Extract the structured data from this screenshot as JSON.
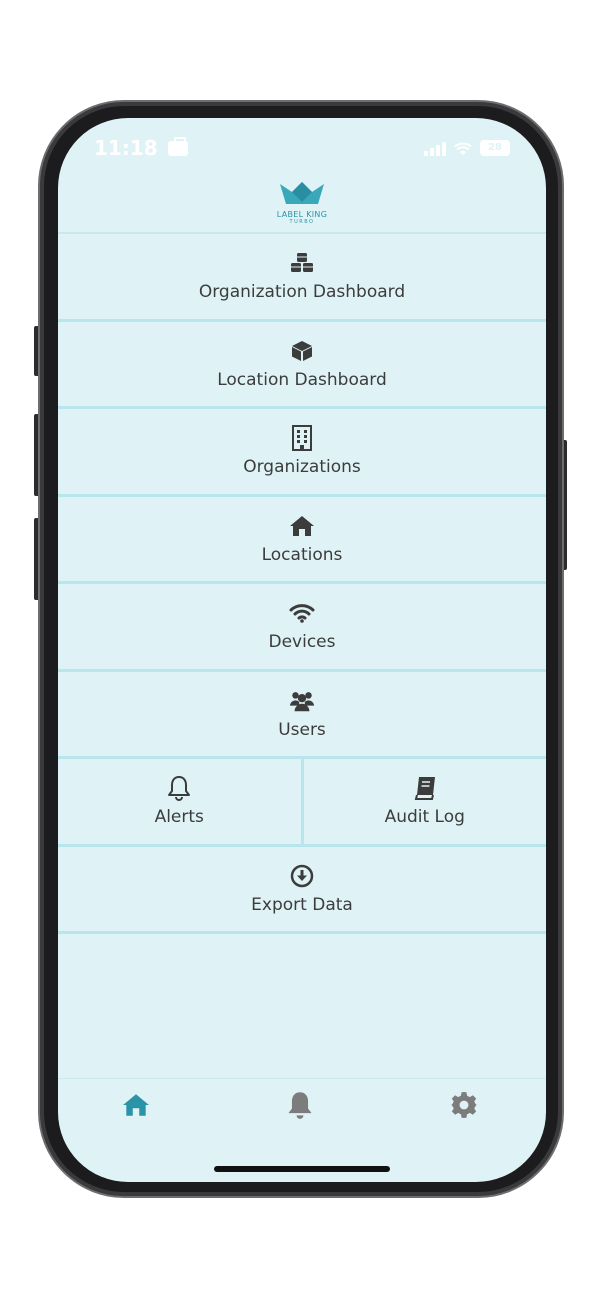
{
  "status_bar": {
    "time": "11:18",
    "battery": "28"
  },
  "header": {
    "logo_text": "LABEL KING",
    "logo_subtext": "TURBO"
  },
  "menu": {
    "organization_dashboard": {
      "label": "Organization Dashboard",
      "icon": "cubes-icon"
    },
    "location_dashboard": {
      "label": "Location Dashboard",
      "icon": "cube-icon"
    },
    "organizations": {
      "label": "Organizations",
      "icon": "building-icon"
    },
    "locations": {
      "label": "Locations",
      "icon": "house-icon"
    },
    "devices": {
      "label": "Devices",
      "icon": "wifi-icon"
    },
    "users": {
      "label": "Users",
      "icon": "users-icon"
    },
    "alerts": {
      "label": "Alerts",
      "icon": "bell-outline-icon"
    },
    "audit_log": {
      "label": "Audit Log",
      "icon": "book-icon"
    },
    "export_data": {
      "label": "Export Data",
      "icon": "download-circle-icon"
    }
  },
  "tabbar": {
    "items": [
      {
        "name": "home",
        "icon": "house-icon",
        "active": true
      },
      {
        "name": "alerts",
        "icon": "bell-icon",
        "active": false
      },
      {
        "name": "settings",
        "icon": "gear-icon",
        "active": false
      }
    ]
  },
  "colors": {
    "background": "#dff3f7",
    "divider": "#b9e5ec",
    "accent": "#2a93a8",
    "icon": "#3c3c3c",
    "inactive_tab": "#7c7c7c"
  }
}
